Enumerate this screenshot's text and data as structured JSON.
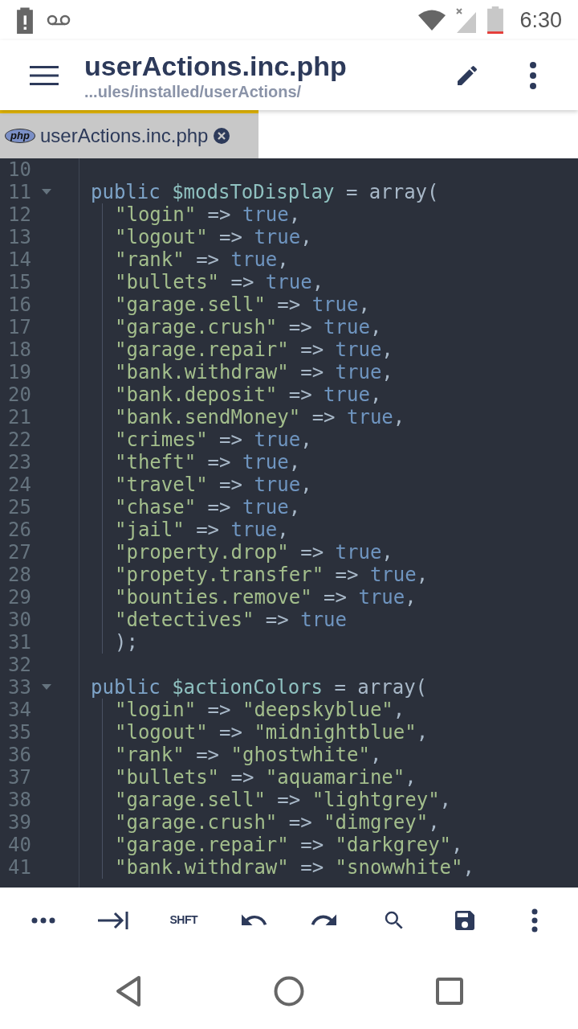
{
  "status_bar": {
    "time": "6:30"
  },
  "app_bar": {
    "title": "userActions.inc.php",
    "subtitle": "...ules/installed/userActions/"
  },
  "tabs": [
    {
      "label": "userActions.inc.php",
      "icon_text": "php",
      "selected": true
    }
  ],
  "editor": {
    "lines": [
      {
        "number": "10",
        "fold": false,
        "indent": false
      },
      {
        "number": "11",
        "fold": true,
        "indent": false,
        "tokens": [
          {
            "kind": "kw",
            "text": "public "
          },
          {
            "kind": "var",
            "text": "$modsToDisplay"
          },
          {
            "kind": "op",
            "text": " = array("
          }
        ]
      },
      {
        "number": "12",
        "fold": false,
        "indent": true,
        "tokens": [
          {
            "kind": "str",
            "text": "\"login\""
          },
          {
            "kind": "op",
            "text": " => "
          },
          {
            "kind": "bool",
            "text": "true"
          },
          {
            "kind": "op",
            "text": ","
          }
        ]
      },
      {
        "number": "13",
        "fold": false,
        "indent": true,
        "tokens": [
          {
            "kind": "str",
            "text": "\"logout\""
          },
          {
            "kind": "op",
            "text": " => "
          },
          {
            "kind": "bool",
            "text": "true"
          },
          {
            "kind": "op",
            "text": ","
          }
        ]
      },
      {
        "number": "14",
        "fold": false,
        "indent": true,
        "tokens": [
          {
            "kind": "str",
            "text": "\"rank\""
          },
          {
            "kind": "op",
            "text": " => "
          },
          {
            "kind": "bool",
            "text": "true"
          },
          {
            "kind": "op",
            "text": ","
          }
        ]
      },
      {
        "number": "15",
        "fold": false,
        "indent": true,
        "tokens": [
          {
            "kind": "str",
            "text": "\"bullets\""
          },
          {
            "kind": "op",
            "text": " => "
          },
          {
            "kind": "bool",
            "text": "true"
          },
          {
            "kind": "op",
            "text": ","
          }
        ]
      },
      {
        "number": "16",
        "fold": false,
        "indent": true,
        "tokens": [
          {
            "kind": "str",
            "text": "\"garage.sell\""
          },
          {
            "kind": "op",
            "text": " => "
          },
          {
            "kind": "bool",
            "text": "true"
          },
          {
            "kind": "op",
            "text": ","
          }
        ]
      },
      {
        "number": "17",
        "fold": false,
        "indent": true,
        "tokens": [
          {
            "kind": "str",
            "text": "\"garage.crush\""
          },
          {
            "kind": "op",
            "text": " => "
          },
          {
            "kind": "bool",
            "text": "true"
          },
          {
            "kind": "op",
            "text": ","
          }
        ]
      },
      {
        "number": "18",
        "fold": false,
        "indent": true,
        "tokens": [
          {
            "kind": "str",
            "text": "\"garage.repair\""
          },
          {
            "kind": "op",
            "text": " => "
          },
          {
            "kind": "bool",
            "text": "true"
          },
          {
            "kind": "op",
            "text": ","
          }
        ]
      },
      {
        "number": "19",
        "fold": false,
        "indent": true,
        "tokens": [
          {
            "kind": "str",
            "text": "\"bank.withdraw\""
          },
          {
            "kind": "op",
            "text": " => "
          },
          {
            "kind": "bool",
            "text": "true"
          },
          {
            "kind": "op",
            "text": ","
          }
        ]
      },
      {
        "number": "20",
        "fold": false,
        "indent": true,
        "tokens": [
          {
            "kind": "str",
            "text": "\"bank.deposit\""
          },
          {
            "kind": "op",
            "text": " => "
          },
          {
            "kind": "bool",
            "text": "true"
          },
          {
            "kind": "op",
            "text": ","
          }
        ]
      },
      {
        "number": "21",
        "fold": false,
        "indent": true,
        "tokens": [
          {
            "kind": "str",
            "text": "\"bank.sendMoney\""
          },
          {
            "kind": "op",
            "text": " => "
          },
          {
            "kind": "bool",
            "text": "true"
          },
          {
            "kind": "op",
            "text": ","
          }
        ]
      },
      {
        "number": "22",
        "fold": false,
        "indent": true,
        "tokens": [
          {
            "kind": "str",
            "text": "\"crimes\""
          },
          {
            "kind": "op",
            "text": " => "
          },
          {
            "kind": "bool",
            "text": "true"
          },
          {
            "kind": "op",
            "text": ","
          }
        ]
      },
      {
        "number": "23",
        "fold": false,
        "indent": true,
        "tokens": [
          {
            "kind": "str",
            "text": "\"theft\""
          },
          {
            "kind": "op",
            "text": " => "
          },
          {
            "kind": "bool",
            "text": "true"
          },
          {
            "kind": "op",
            "text": ","
          }
        ]
      },
      {
        "number": "24",
        "fold": false,
        "indent": true,
        "tokens": [
          {
            "kind": "str",
            "text": "\"travel\""
          },
          {
            "kind": "op",
            "text": " => "
          },
          {
            "kind": "bool",
            "text": "true"
          },
          {
            "kind": "op",
            "text": ","
          }
        ]
      },
      {
        "number": "25",
        "fold": false,
        "indent": true,
        "tokens": [
          {
            "kind": "str",
            "text": "\"chase\""
          },
          {
            "kind": "op",
            "text": " => "
          },
          {
            "kind": "bool",
            "text": "true"
          },
          {
            "kind": "op",
            "text": ","
          }
        ]
      },
      {
        "number": "26",
        "fold": false,
        "indent": true,
        "tokens": [
          {
            "kind": "str",
            "text": "\"jail\""
          },
          {
            "kind": "op",
            "text": " => "
          },
          {
            "kind": "bool",
            "text": "true"
          },
          {
            "kind": "op",
            "text": ","
          }
        ]
      },
      {
        "number": "27",
        "fold": false,
        "indent": true,
        "tokens": [
          {
            "kind": "str",
            "text": "\"property.drop\""
          },
          {
            "kind": "op",
            "text": " => "
          },
          {
            "kind": "bool",
            "text": "true"
          },
          {
            "kind": "op",
            "text": ","
          }
        ]
      },
      {
        "number": "28",
        "fold": false,
        "indent": true,
        "tokens": [
          {
            "kind": "str",
            "text": "\"propety.transfer\""
          },
          {
            "kind": "op",
            "text": " => "
          },
          {
            "kind": "bool",
            "text": "true"
          },
          {
            "kind": "op",
            "text": ","
          }
        ]
      },
      {
        "number": "29",
        "fold": false,
        "indent": true,
        "tokens": [
          {
            "kind": "str",
            "text": "\"bounties.remove\""
          },
          {
            "kind": "op",
            "text": " => "
          },
          {
            "kind": "bool",
            "text": "true"
          },
          {
            "kind": "op",
            "text": ","
          }
        ]
      },
      {
        "number": "30",
        "fold": false,
        "indent": true,
        "tokens": [
          {
            "kind": "str",
            "text": "\"detectives\""
          },
          {
            "kind": "op",
            "text": " => "
          },
          {
            "kind": "bool",
            "text": "true"
          }
        ]
      },
      {
        "number": "31",
        "fold": false,
        "indent": true,
        "tokens": [
          {
            "kind": "op",
            "text": ");"
          }
        ]
      },
      {
        "number": "32",
        "fold": false,
        "indent": false
      },
      {
        "number": "33",
        "fold": true,
        "indent": false,
        "tokens": [
          {
            "kind": "kw",
            "text": "public "
          },
          {
            "kind": "var",
            "text": "$actionColors"
          },
          {
            "kind": "op",
            "text": " = array("
          }
        ]
      },
      {
        "number": "34",
        "fold": false,
        "indent": true,
        "tokens": [
          {
            "kind": "str",
            "text": "\"login\""
          },
          {
            "kind": "op",
            "text": " => "
          },
          {
            "kind": "str",
            "text": "\"deepskyblue\""
          },
          {
            "kind": "op",
            "text": ","
          }
        ]
      },
      {
        "number": "35",
        "fold": false,
        "indent": true,
        "tokens": [
          {
            "kind": "str",
            "text": "\"logout\""
          },
          {
            "kind": "op",
            "text": " => "
          },
          {
            "kind": "str",
            "text": "\"midnightblue\""
          },
          {
            "kind": "op",
            "text": ","
          }
        ]
      },
      {
        "number": "36",
        "fold": false,
        "indent": true,
        "tokens": [
          {
            "kind": "str",
            "text": "\"rank\""
          },
          {
            "kind": "op",
            "text": " => "
          },
          {
            "kind": "str",
            "text": "\"ghostwhite\""
          },
          {
            "kind": "op",
            "text": ","
          }
        ]
      },
      {
        "number": "37",
        "fold": false,
        "indent": true,
        "tokens": [
          {
            "kind": "str",
            "text": "\"bullets\""
          },
          {
            "kind": "op",
            "text": " => "
          },
          {
            "kind": "str",
            "text": "\"aquamarine\""
          },
          {
            "kind": "op",
            "text": ","
          }
        ]
      },
      {
        "number": "38",
        "fold": false,
        "indent": true,
        "tokens": [
          {
            "kind": "str",
            "text": "\"garage.sell\""
          },
          {
            "kind": "op",
            "text": " => "
          },
          {
            "kind": "str",
            "text": "\"lightgrey\""
          },
          {
            "kind": "op",
            "text": ","
          }
        ]
      },
      {
        "number": "39",
        "fold": false,
        "indent": true,
        "tokens": [
          {
            "kind": "str",
            "text": "\"garage.crush\""
          },
          {
            "kind": "op",
            "text": " => "
          },
          {
            "kind": "str",
            "text": "\"dimgrey\""
          },
          {
            "kind": "op",
            "text": ","
          }
        ]
      },
      {
        "number": "40",
        "fold": false,
        "indent": true,
        "tokens": [
          {
            "kind": "str",
            "text": "\"garage.repair\""
          },
          {
            "kind": "op",
            "text": " => "
          },
          {
            "kind": "str",
            "text": "\"darkgrey\""
          },
          {
            "kind": "op",
            "text": ","
          }
        ]
      },
      {
        "number": "41",
        "fold": false,
        "indent": true,
        "tokens": [
          {
            "kind": "str",
            "text": "\"bank.withdraw\""
          },
          {
            "kind": "op",
            "text": " => "
          },
          {
            "kind": "str",
            "text": "\"snowwhite\""
          },
          {
            "kind": "op",
            "text": ","
          }
        ]
      }
    ]
  },
  "toolbar": {
    "shift_label": "SHFT"
  }
}
